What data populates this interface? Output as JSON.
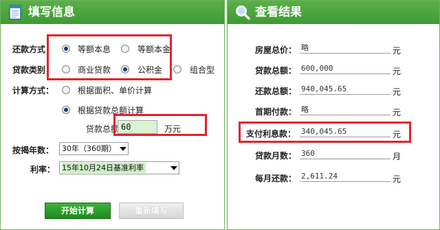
{
  "left": {
    "title": "填写信息",
    "repay_method": {
      "label": "还款方式：",
      "options": [
        "等额本息",
        "等额本金"
      ],
      "selected": 0
    },
    "loan_type": {
      "label": "贷款类别：",
      "options": [
        "商业贷款",
        "公积金",
        "组合型"
      ],
      "selected": 1
    },
    "calc_method": {
      "label": "计算方式：",
      "options": [
        "根据面积、单价计算",
        "根据贷款总额计算"
      ],
      "selected": 1,
      "loan_total_label": "贷款总额",
      "loan_total_value": "60",
      "loan_total_unit": "万元"
    },
    "years": {
      "label": "按揭年数：",
      "value": "30年（360期）"
    },
    "rate": {
      "label": "利率：",
      "value": "15年10月24日基准利率"
    },
    "start_button": "开始计算",
    "reset_button": "重新填写"
  },
  "right": {
    "title": "查看结果",
    "rows": [
      {
        "label": "房屋总价：",
        "value": "略",
        "unit": "元"
      },
      {
        "label": "贷款总额：",
        "value": "600,000",
        "unit": "元"
      },
      {
        "label": "还款总额：",
        "value": "940,045.65",
        "unit": "元"
      },
      {
        "label": "首期付款：",
        "value": "略",
        "unit": "元"
      },
      {
        "label": "支付利息款：",
        "value": "340,045.65",
        "unit": "元"
      },
      {
        "label": "贷款月数：",
        "value": "360",
        "unit": "月"
      },
      {
        "label": "每月还款：",
        "value": "2,611.24",
        "unit": "元"
      }
    ]
  },
  "colors": {
    "header": "#4aa53d",
    "highlight": "#e6202a",
    "input_bg": "#d9f3d3"
  },
  "icons": {
    "left_header": "notepad-icon",
    "right_header": "magnifier-icon"
  }
}
